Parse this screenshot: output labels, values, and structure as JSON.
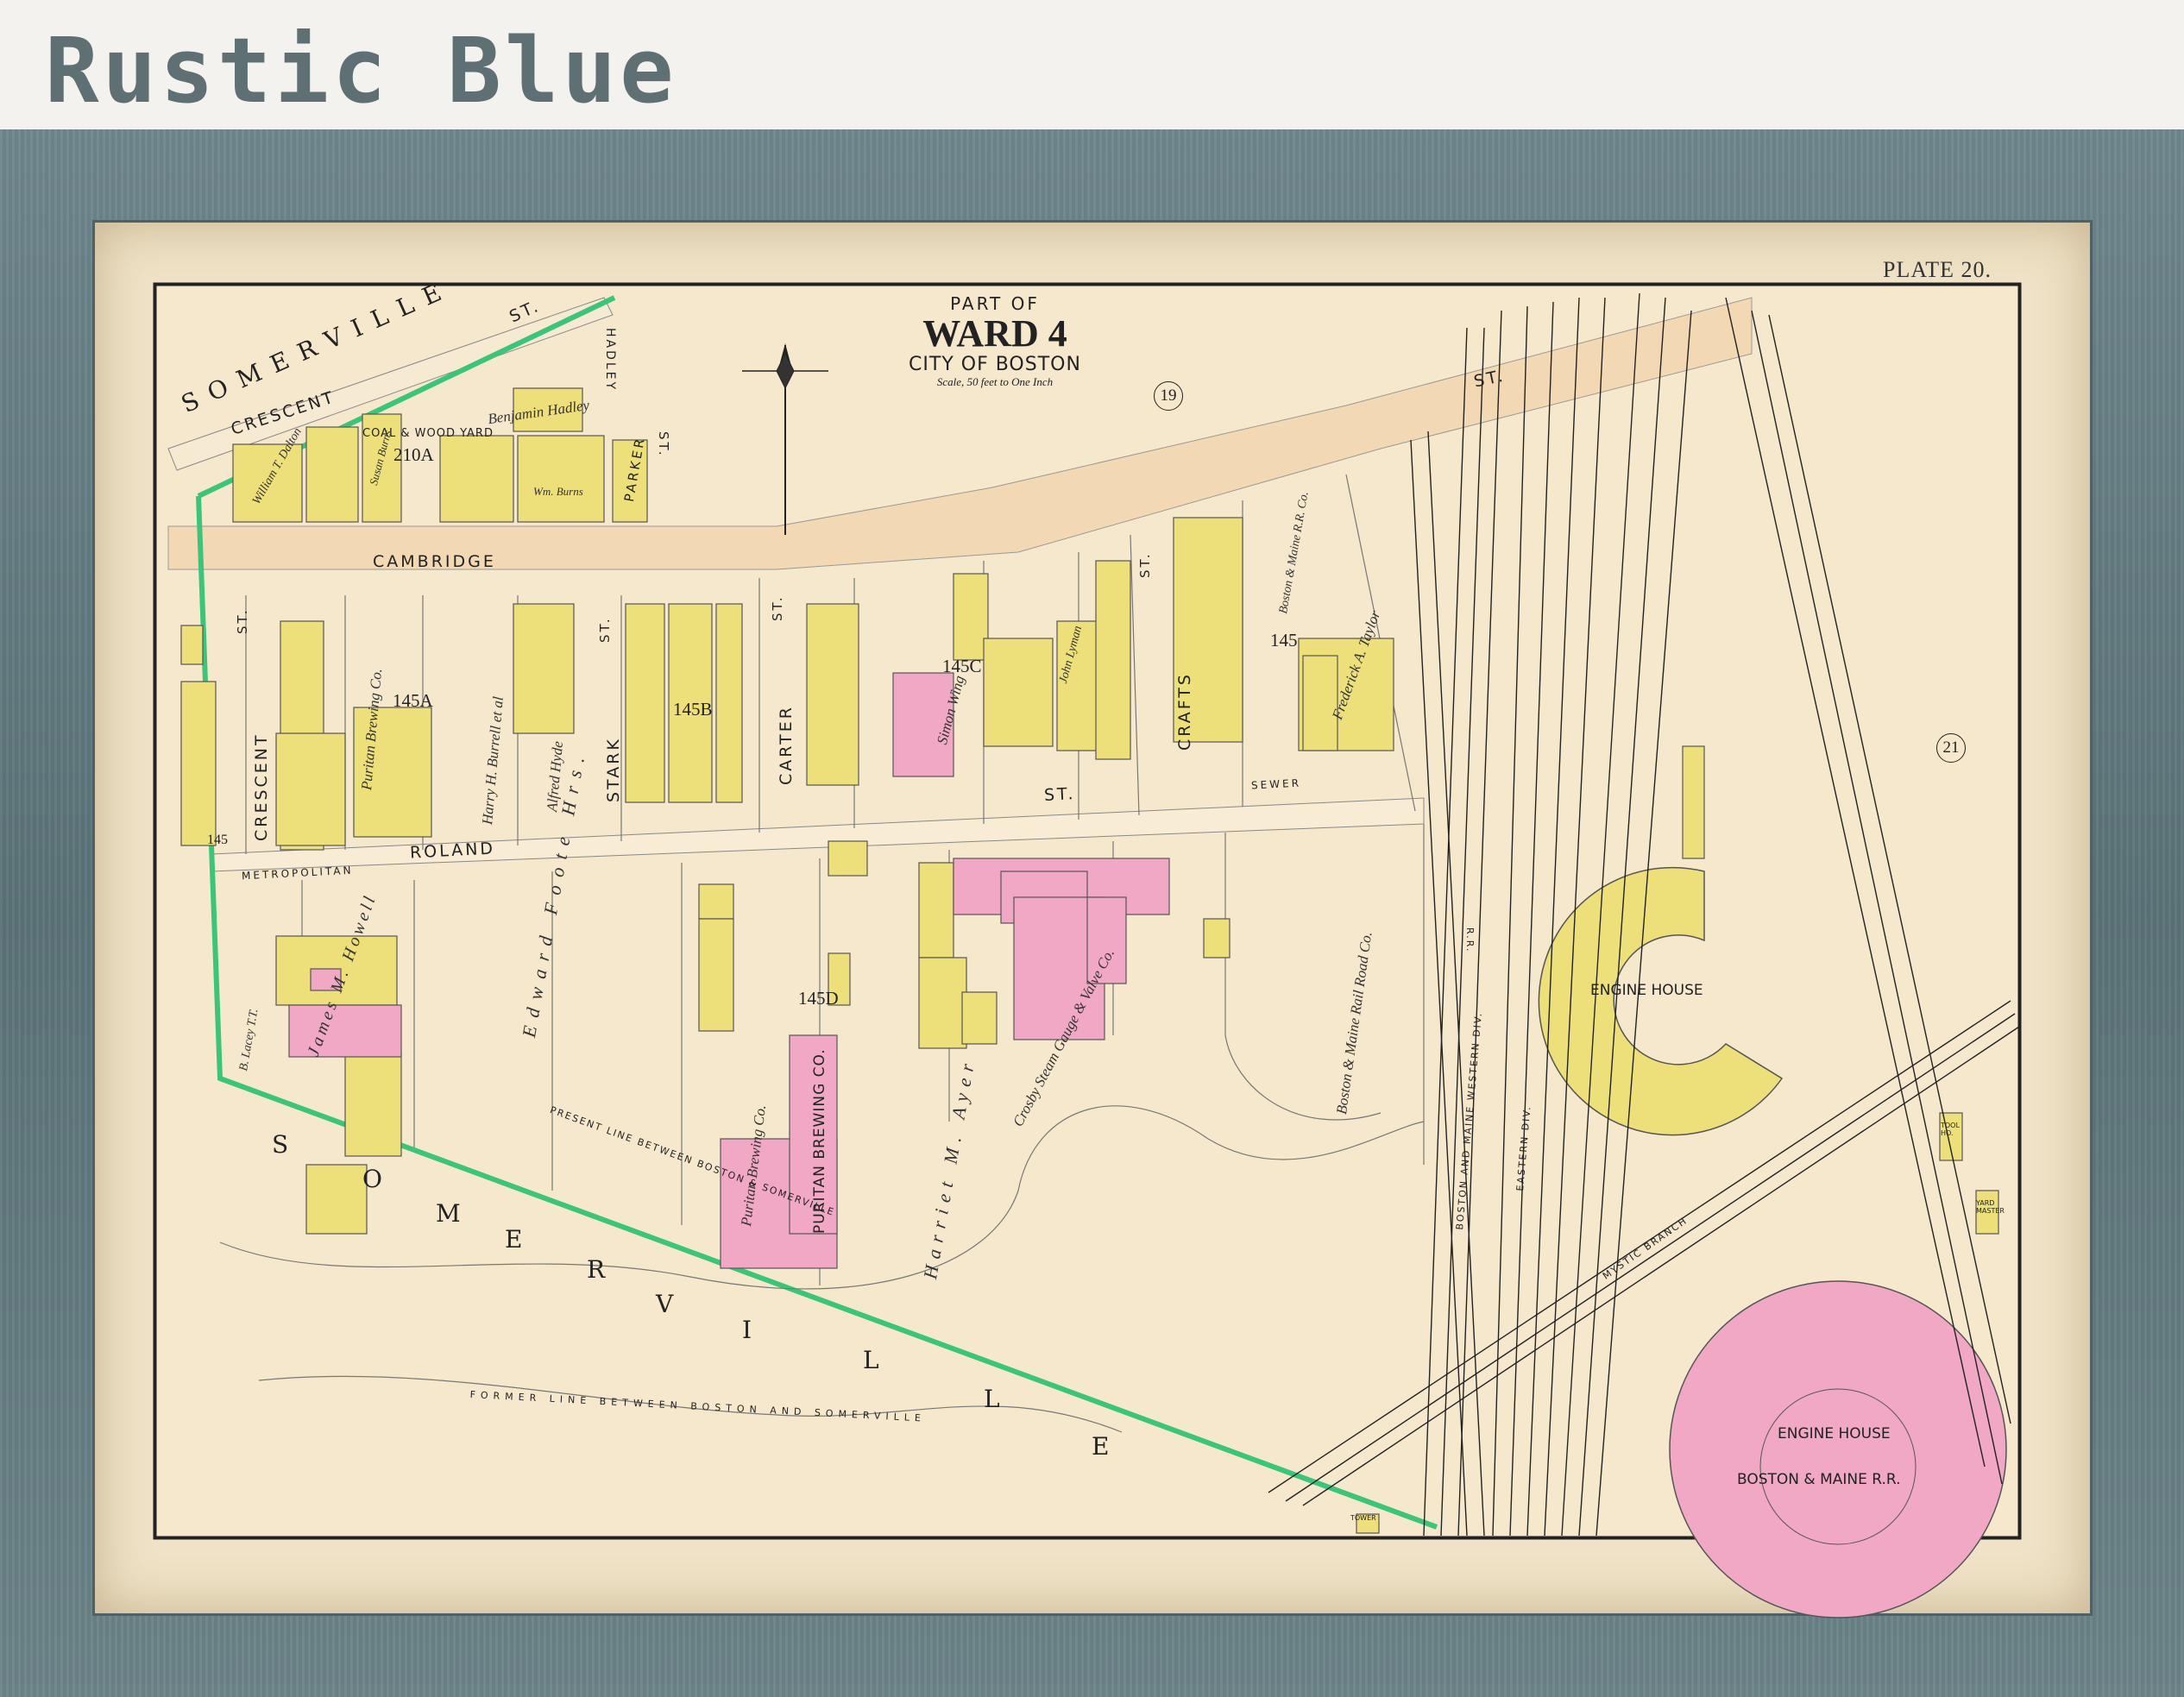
{
  "frame_title": "Rustic Blue",
  "plate": "PLATE 20.",
  "title": {
    "part_of": "PART OF",
    "ward": "WARD 4",
    "city": "CITY OF BOSTON",
    "scale": "Scale, 50 feet to One Inch"
  },
  "ward_markers": [
    "19",
    "21"
  ],
  "streets": {
    "somerville_st": "SOMERVILLE",
    "somerville_st_suffix": "ST.",
    "crescent_top": "CRESCENT",
    "hadley": "HADLEY",
    "parker_st": "ST.",
    "parker": "PARKER",
    "cambridge": "CAMBRIDGE",
    "cambridge_st": "ST.",
    "crescent_st": "ST.",
    "crescent": "CRESCENT",
    "stark_st": "ST.",
    "stark": "STARK",
    "carter_st": "ST.",
    "carter": "CARTER",
    "crafts_st": "ST.",
    "crafts": "CRAFTS",
    "roland": "ROLAND",
    "roland_st": "ST.",
    "metropolitan": "METROPOLITAN",
    "sewer": "SEWER",
    "somerville_area": [
      "S",
      "O",
      "M",
      "E",
      "R",
      "V",
      "I",
      "L",
      "L",
      "E"
    ]
  },
  "lots": {
    "a210": "210A",
    "a145": "145A",
    "b145": "145B",
    "c145": "145C",
    "d145": "145D",
    "n145": "145",
    "edge145": "145"
  },
  "labels": {
    "coal_yard": "COAL & WOOD YARD",
    "benjamin_hadley": "Benjamin Hadley",
    "william_dalton": "William T. Dalton",
    "susan_burns": "Susan Burns",
    "wm_burns": "Wm. Burns",
    "puritan_brewing_bldg": "PURITAN BREWING CO.",
    "puritan_brewing_owner": "Puritan Brewing Co.",
    "puritan_brewing_2": "Puritan Brewing Co.",
    "harry_burrell": "Harry H. Burrell et al",
    "alfred_hyde": "Alfred Hyde",
    "simon_wing": "Simon Wing",
    "john_lyman": "John Lyman",
    "boston_maine_rr_co": "Boston & Maine R.R. Co.",
    "frederick_taylor": "Frederick A. Taylor",
    "edward_foote": "Edward Foote Hrs.",
    "harriet_ayer": "Harriet M. Ayer",
    "crosby_steam": "Crosby Steam Gauge & Valve Co.",
    "boston_maine_rail_road": "Boston & Maine Rail Road Co.",
    "james_howell": "James M. Howell",
    "b_lacey": "B. Lacey T.T.",
    "present_line": "PRESENT LINE BETWEEN BOSTON & SOMERVILLE",
    "former_line": "FORMER LINE BETWEEN BOSTON AND SOMERVILLE",
    "bm_western_div": "BOSTON AND MAINE WESTERN DIV.",
    "eastern_div": "EASTERN DIV.",
    "mystic_branch": "MYSTIC BRANCH",
    "rr": "R.R.",
    "engine_house_1": "ENGINE HOUSE",
    "engine_house_2": "ENGINE HOUSE",
    "boston_maine_rr": "BOSTON & MAINE R.R.",
    "tower": "TOWER",
    "tool_ho": "TOOL HO.",
    "yard_master": "YARD MASTER"
  },
  "colors": {
    "paper": "#f6e8cc",
    "street": "#f2d9b4",
    "brick": "#f0a8c4",
    "wood": "#ede07a",
    "boundary": "#3cc47a",
    "frame": "#647c81"
  }
}
